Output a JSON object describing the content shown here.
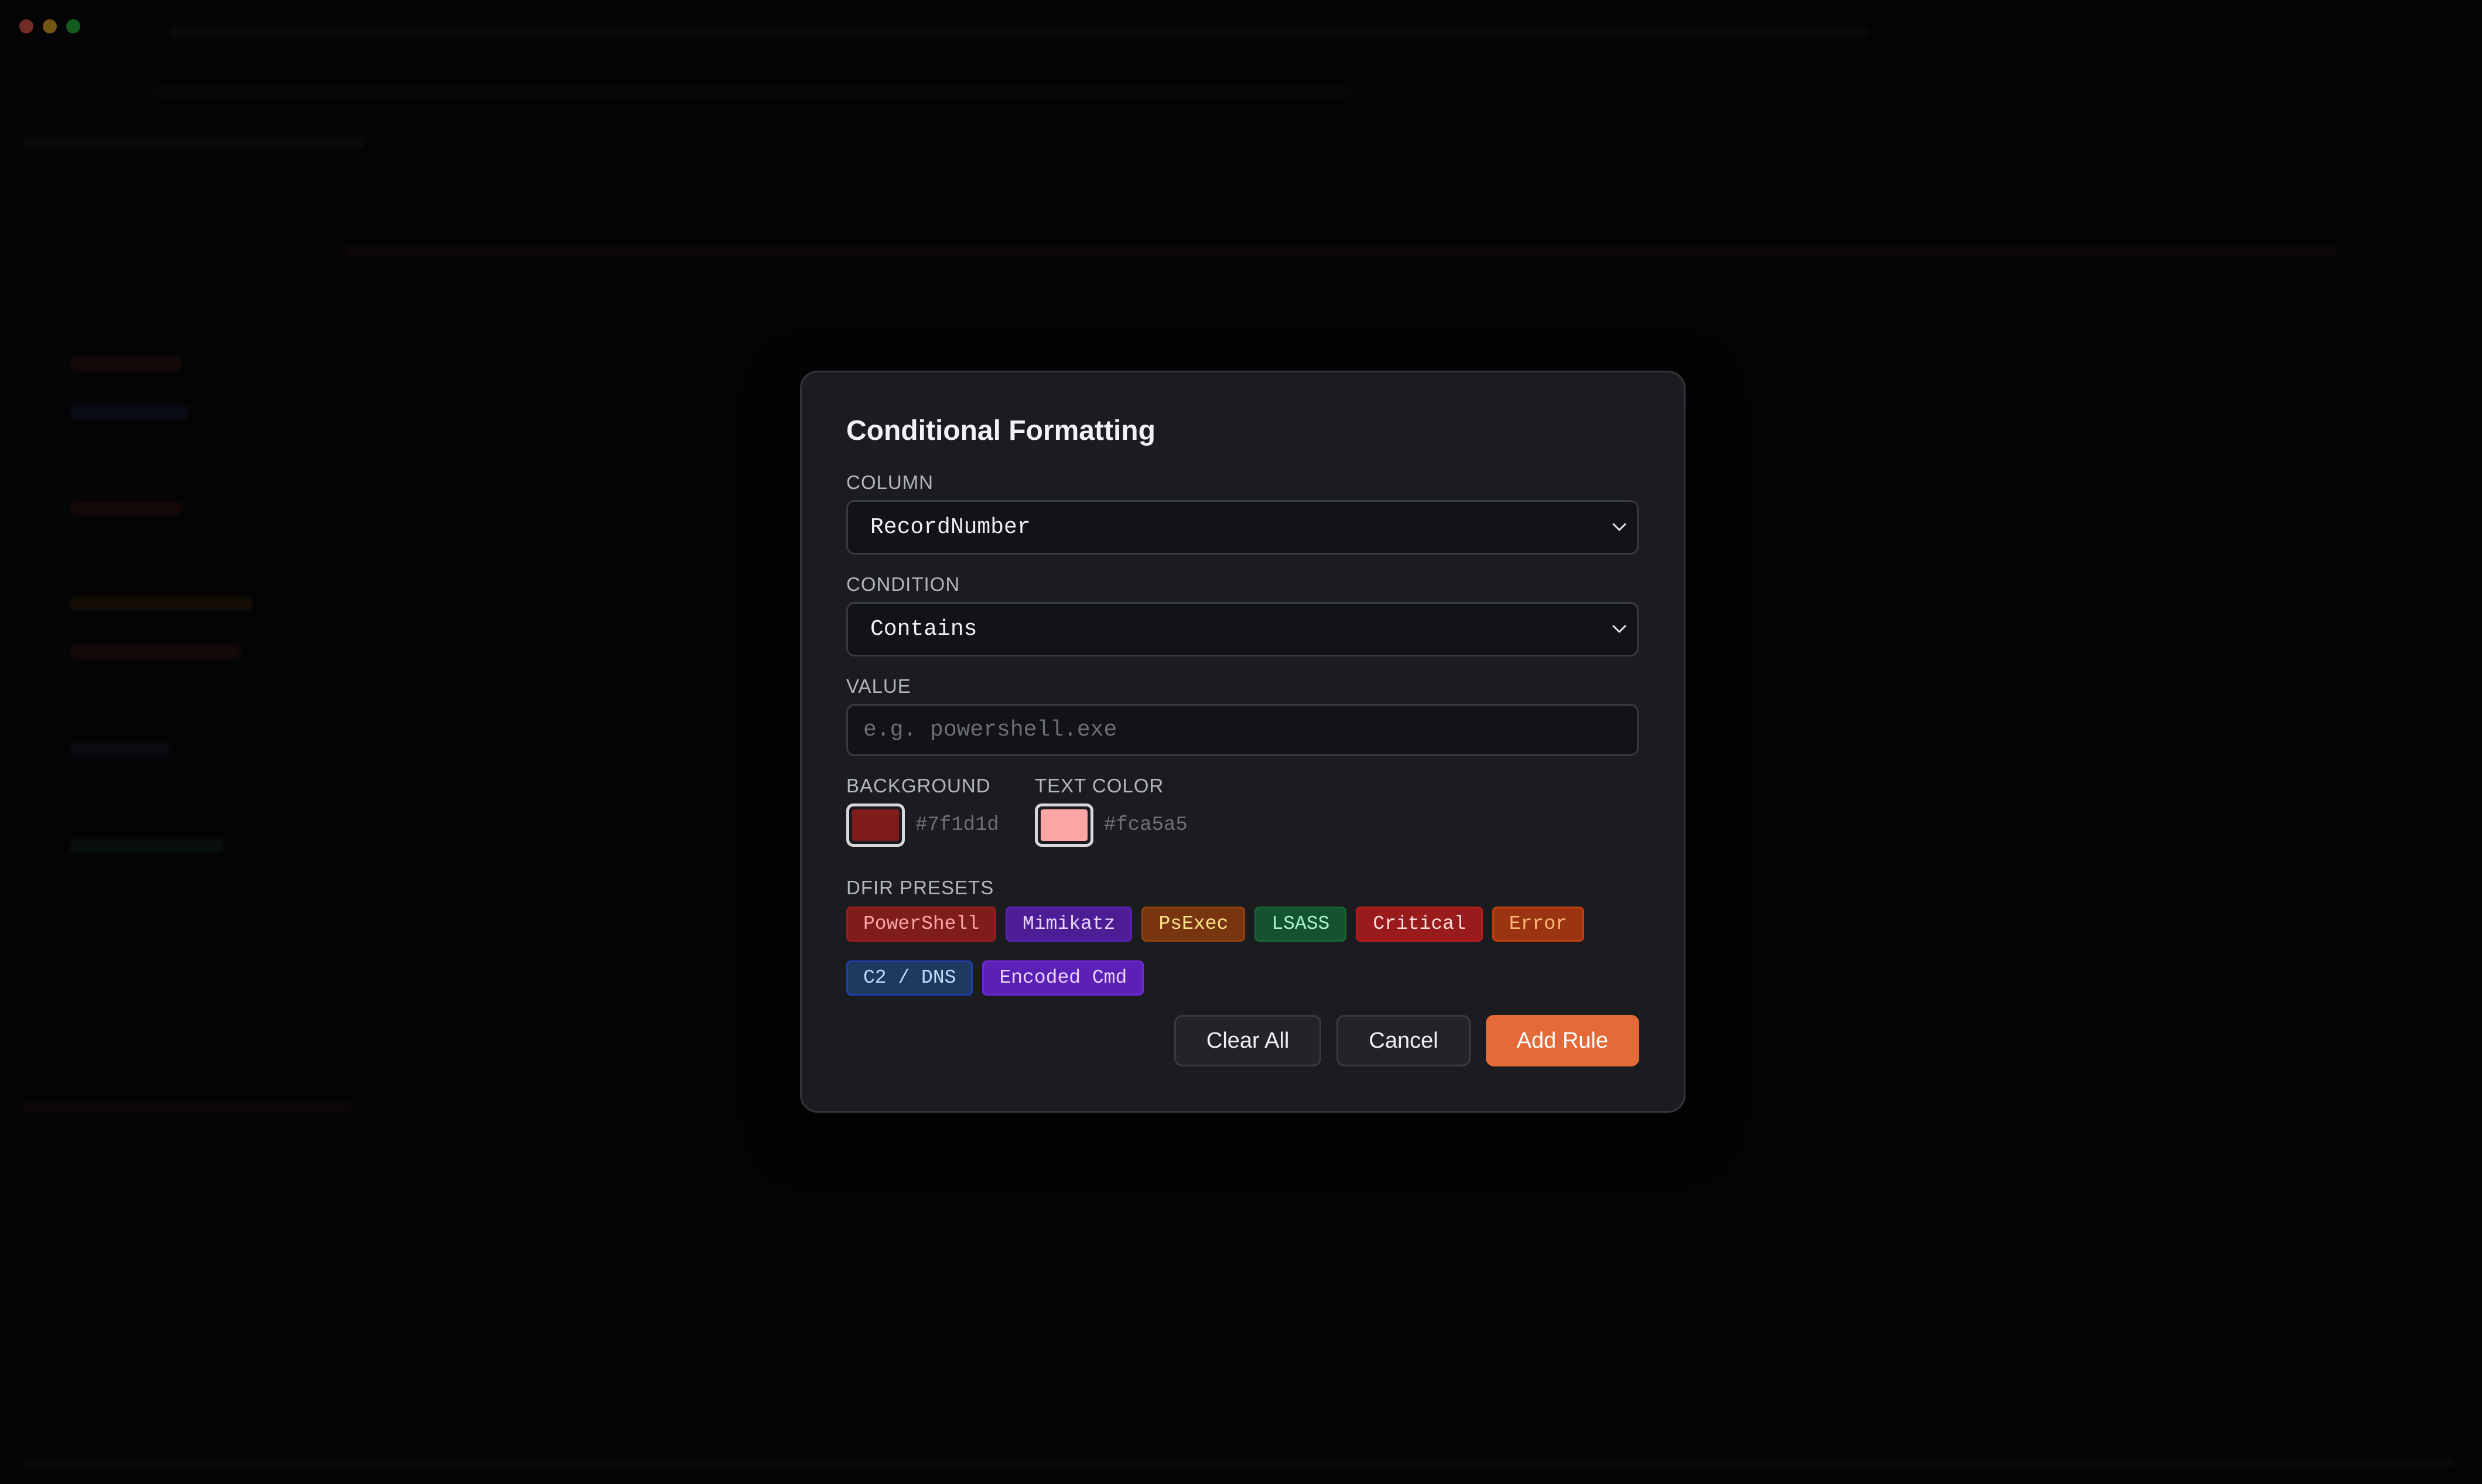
{
  "window": {
    "traffic_lights": [
      "#ff5f57",
      "#febc2e",
      "#28c840"
    ]
  },
  "dialog": {
    "title": "Conditional Formatting",
    "column": {
      "label": "COLUMN",
      "selected": "RecordNumber",
      "icon": "chevron-down-icon"
    },
    "condition": {
      "label": "CONDITION",
      "selected": "Contains",
      "icon": "chevron-down-icon"
    },
    "value": {
      "label": "VALUE",
      "value": "",
      "placeholder": "e.g. powershell.exe"
    },
    "background": {
      "label": "BACKGROUND",
      "hex": "#7f1d1d"
    },
    "text_color": {
      "label": "TEXT COLOR",
      "hex": "#fca5a5"
    },
    "presets": {
      "label": "DFIR PRESETS",
      "items": [
        {
          "label": "PowerShell",
          "bg": "#7f1d1d",
          "fg": "#fca5a5",
          "border": "#991b1b"
        },
        {
          "label": "Mimikatz",
          "bg": "#4c1d95",
          "fg": "#e9d5ff",
          "border": "#5b21b6"
        },
        {
          "label": "PsExec",
          "bg": "#78350f",
          "fg": "#fde68a",
          "border": "#92400e"
        },
        {
          "label": "LSASS",
          "bg": "#14532d",
          "fg": "#a7f3d0",
          "border": "#166534"
        },
        {
          "label": "Critical",
          "bg": "#991b1b",
          "fg": "#fee2e2",
          "border": "#b91c1c"
        },
        {
          "label": "Error",
          "bg": "#9a3412",
          "fg": "#fdba74",
          "border": "#c2410c"
        },
        {
          "label": "C2 / DNS",
          "bg": "#1e3a5f",
          "fg": "#bfdbfe",
          "border": "#1e40af"
        },
        {
          "label": "Encoded Cmd",
          "bg": "#5b21b6",
          "fg": "#e9d5ff",
          "border": "#6d28d9"
        }
      ]
    },
    "buttons": {
      "clear": "Clear All",
      "cancel": "Cancel",
      "add": "Add Rule"
    },
    "accent": "#e46a38"
  }
}
